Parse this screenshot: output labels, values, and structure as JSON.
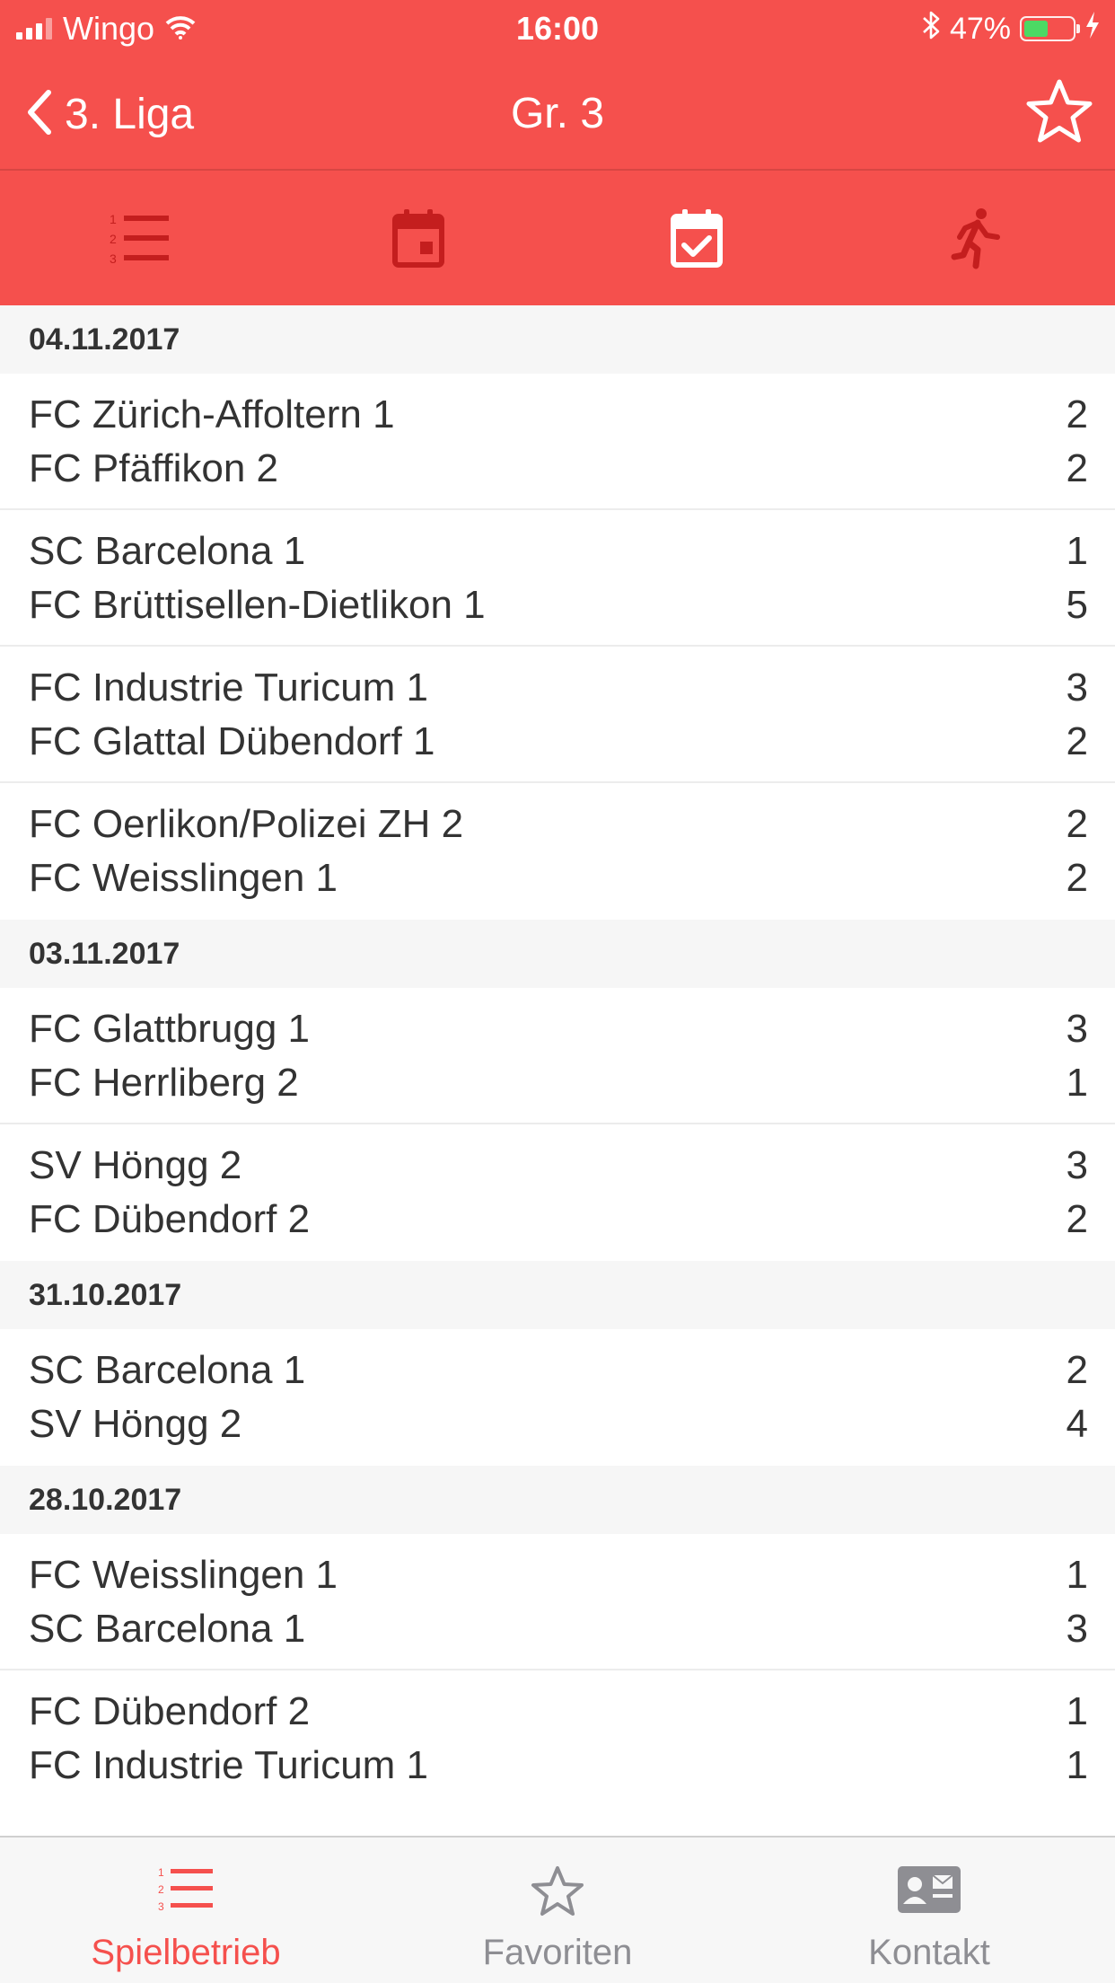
{
  "status_bar": {
    "carrier": "Wingo",
    "time": "16:00",
    "battery": "47%"
  },
  "nav": {
    "back_label": "3. Liga",
    "title": "Gr. 3"
  },
  "tabs": [
    {
      "name": "ranking-tab",
      "icon": "numbered-list-icon",
      "selected": false
    },
    {
      "name": "schedule-tab",
      "icon": "calendar-icon",
      "selected": false
    },
    {
      "name": "results-tab",
      "icon": "calendar-check-icon",
      "selected": true
    },
    {
      "name": "players-tab",
      "icon": "running-person-icon",
      "selected": false
    }
  ],
  "groups": [
    {
      "date": "04.11.2017",
      "matches": [
        {
          "home": "FC Zürich-Affoltern 1",
          "home_score": "2",
          "away": "FC Pfäffikon 2",
          "away_score": "2"
        },
        {
          "home": "SC Barcelona 1",
          "home_score": "1",
          "away": "FC Brüttisellen-Dietlikon 1",
          "away_score": "5"
        },
        {
          "home": "FC Industrie Turicum 1",
          "home_score": "3",
          "away": "FC Glattal Dübendorf 1",
          "away_score": "2"
        },
        {
          "home": "FC Oerlikon/Polizei ZH 2",
          "home_score": "2",
          "away": "FC Weisslingen 1",
          "away_score": "2"
        }
      ]
    },
    {
      "date": "03.11.2017",
      "matches": [
        {
          "home": "FC Glattbrugg 1",
          "home_score": "3",
          "away": "FC Herrliberg 2",
          "away_score": "1"
        },
        {
          "home": "SV Höngg 2",
          "home_score": "3",
          "away": "FC Dübendorf 2",
          "away_score": "2"
        }
      ]
    },
    {
      "date": "31.10.2017",
      "matches": [
        {
          "home": "SC Barcelona 1",
          "home_score": "2",
          "away": "SV Höngg 2",
          "away_score": "4"
        }
      ]
    },
    {
      "date": "28.10.2017",
      "matches": [
        {
          "home": "FC Weisslingen 1",
          "home_score": "1",
          "away": "SC Barcelona 1",
          "away_score": "3"
        },
        {
          "home": "FC Dübendorf 2",
          "home_score": "1",
          "away": "FC Industrie Turicum 1",
          "away_score": "1"
        }
      ]
    }
  ],
  "bottom_tabs": [
    {
      "label": "Spielbetrieb",
      "icon": "numbered-list-icon",
      "active": true
    },
    {
      "label": "Favoriten",
      "icon": "star-icon",
      "active": false
    },
    {
      "label": "Kontakt",
      "icon": "contact-card-icon",
      "active": false
    }
  ],
  "colors": {
    "accent": "#f5504d",
    "tab_icon_inactive": "#c41e1e",
    "text": "#333333",
    "section_bg": "#f6f6f6"
  }
}
